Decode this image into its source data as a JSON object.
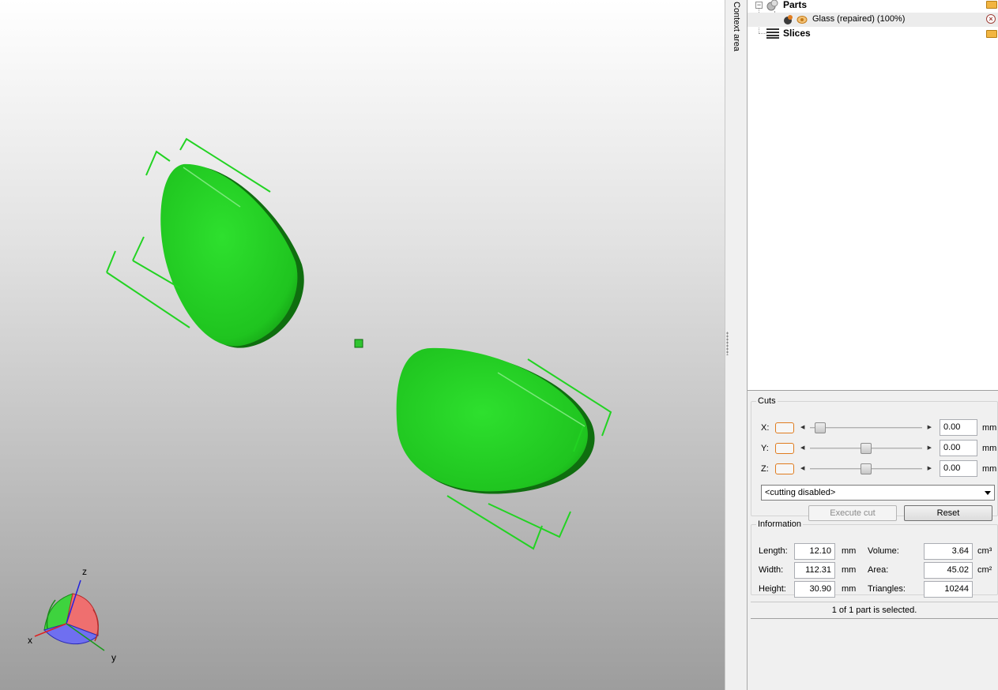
{
  "context_strip": {
    "label": "Context area"
  },
  "tree": {
    "parts_label": "Parts",
    "part_item_label": "Glass (repaired) (100%)",
    "slices_label": "Slices",
    "expander_symbol": "−",
    "close_symbol": "×"
  },
  "cuts": {
    "title": "Cuts",
    "axes": [
      {
        "label": "X:",
        "value": "0.00",
        "unit": "mm",
        "slider_level": 0.05
      },
      {
        "label": "Y:",
        "value": "0.00",
        "unit": "mm",
        "slider_level": 0.5
      },
      {
        "label": "Z:",
        "value": "0.00",
        "unit": "mm",
        "slider_level": 0.5
      }
    ],
    "mode_select": "<cutting disabled>",
    "execute_button": "Execute cut",
    "reset_button": "Reset"
  },
  "information": {
    "title": "Information",
    "length_label": "Length:",
    "length_value": "12.10",
    "length_unit": "mm",
    "width_label": "Width:",
    "width_value": "112.31",
    "width_unit": "mm",
    "height_label": "Height:",
    "height_value": "30.90",
    "height_unit": "mm",
    "volume_label": "Volume:",
    "volume_value": "3.64",
    "volume_unit": "cm³",
    "area_label": "Area:",
    "area_value": "45.02",
    "area_unit": "cm²",
    "triangles_label": "Triangles:",
    "triangles_value": "10244"
  },
  "status": {
    "text": "1 of 1 part is selected."
  },
  "axes_gizmo": {
    "x_label": "x",
    "y_label": "y",
    "z_label": "z"
  },
  "colors": {
    "model_green": "#1fc41f",
    "accent_orange": "#e07c1f"
  }
}
